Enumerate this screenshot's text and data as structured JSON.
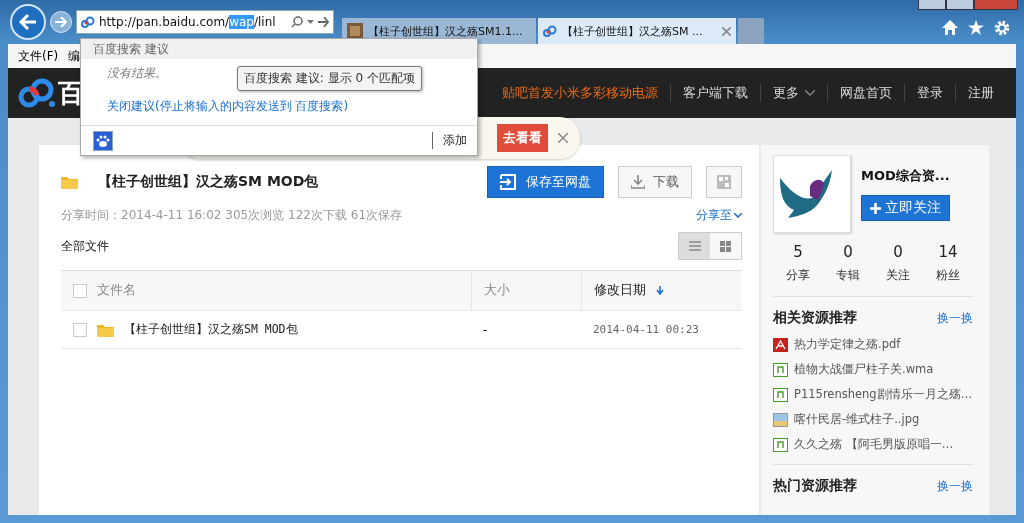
{
  "browser": {
    "address": {
      "parts": [
        {
          "text": "http://pan.baidu.com/",
          "selected": false
        },
        {
          "text": "wap",
          "selected": true
        },
        {
          "text": "/linl",
          "selected": false
        }
      ]
    },
    "tabs": [
      {
        "title": "【柱子创世组】汉之殇SM1.1...",
        "selected": false,
        "kind": "thumb"
      },
      {
        "title": "【柱子创世组】汉之殇SM ...",
        "selected": true,
        "kind": "site"
      }
    ],
    "menu": [
      "文件(F)",
      "编"
    ]
  },
  "suggest": {
    "header": "百度搜索 建议",
    "empty": "没有结果。",
    "close_link": "关闭建议(停止将输入的内容发送到 百度搜索)",
    "add": "添加",
    "tooltip": "百度搜索 建议: 显示 0 个匹配项"
  },
  "promo": {
    "button": "去看看"
  },
  "nav": {
    "logo": "百",
    "links": [
      {
        "label": "贴吧首发小米多彩移动电源",
        "kind": "promo"
      },
      {
        "label": "客户端下载",
        "kind": "link"
      },
      {
        "label": "更多",
        "kind": "menu"
      },
      {
        "label": "网盘首页",
        "kind": "link"
      },
      {
        "label": "登录",
        "kind": "link"
      },
      {
        "label": "注册",
        "kind": "link"
      }
    ]
  },
  "share": {
    "title": "【柱子创世组】汉之殇SM MOD包",
    "save": "保存至网盘",
    "download": "下载",
    "meta": "分享时间：2014-4-11 16:02 305次浏览 122次下载 61次保存",
    "share_to": "分享至",
    "all_files": "全部文件",
    "views": [
      {
        "kind": "list",
        "selected": true
      },
      {
        "kind": "grid",
        "selected": false
      }
    ],
    "columns": [
      "文件名",
      "大小",
      "修改日期"
    ],
    "select_all": {
      "checked": false
    },
    "rows": [
      {
        "name": "【柱子创世组】汉之殇SM MOD包",
        "size": "-",
        "date": "2014-04-11 00:23",
        "checked": false
      }
    ]
  },
  "profile": {
    "name": "MOD综合资...",
    "follow": "立即关注",
    "stats": [
      {
        "value": "5",
        "label": "分享"
      },
      {
        "value": "0",
        "label": "专辑"
      },
      {
        "value": "0",
        "label": "关注"
      },
      {
        "value": "14",
        "label": "粉丝"
      }
    ]
  },
  "related": {
    "title": "相关资源推荐",
    "refresh": "换一换",
    "items": [
      {
        "kind": "pdf",
        "name": "热力学定律之殇.pdf"
      },
      {
        "kind": "audio",
        "name": "植物大战僵尸柱子关.wma"
      },
      {
        "kind": "audio",
        "name": "P115rensheng剧情乐一月之殇…"
      },
      {
        "kind": "image",
        "name": "喀什民居-维式柱子..jpg"
      },
      {
        "kind": "audio",
        "name": "久久之殇 【阿毛男版原唱一…"
      }
    ]
  },
  "hot": {
    "title": "热门资源推荐",
    "refresh": "换一换"
  }
}
